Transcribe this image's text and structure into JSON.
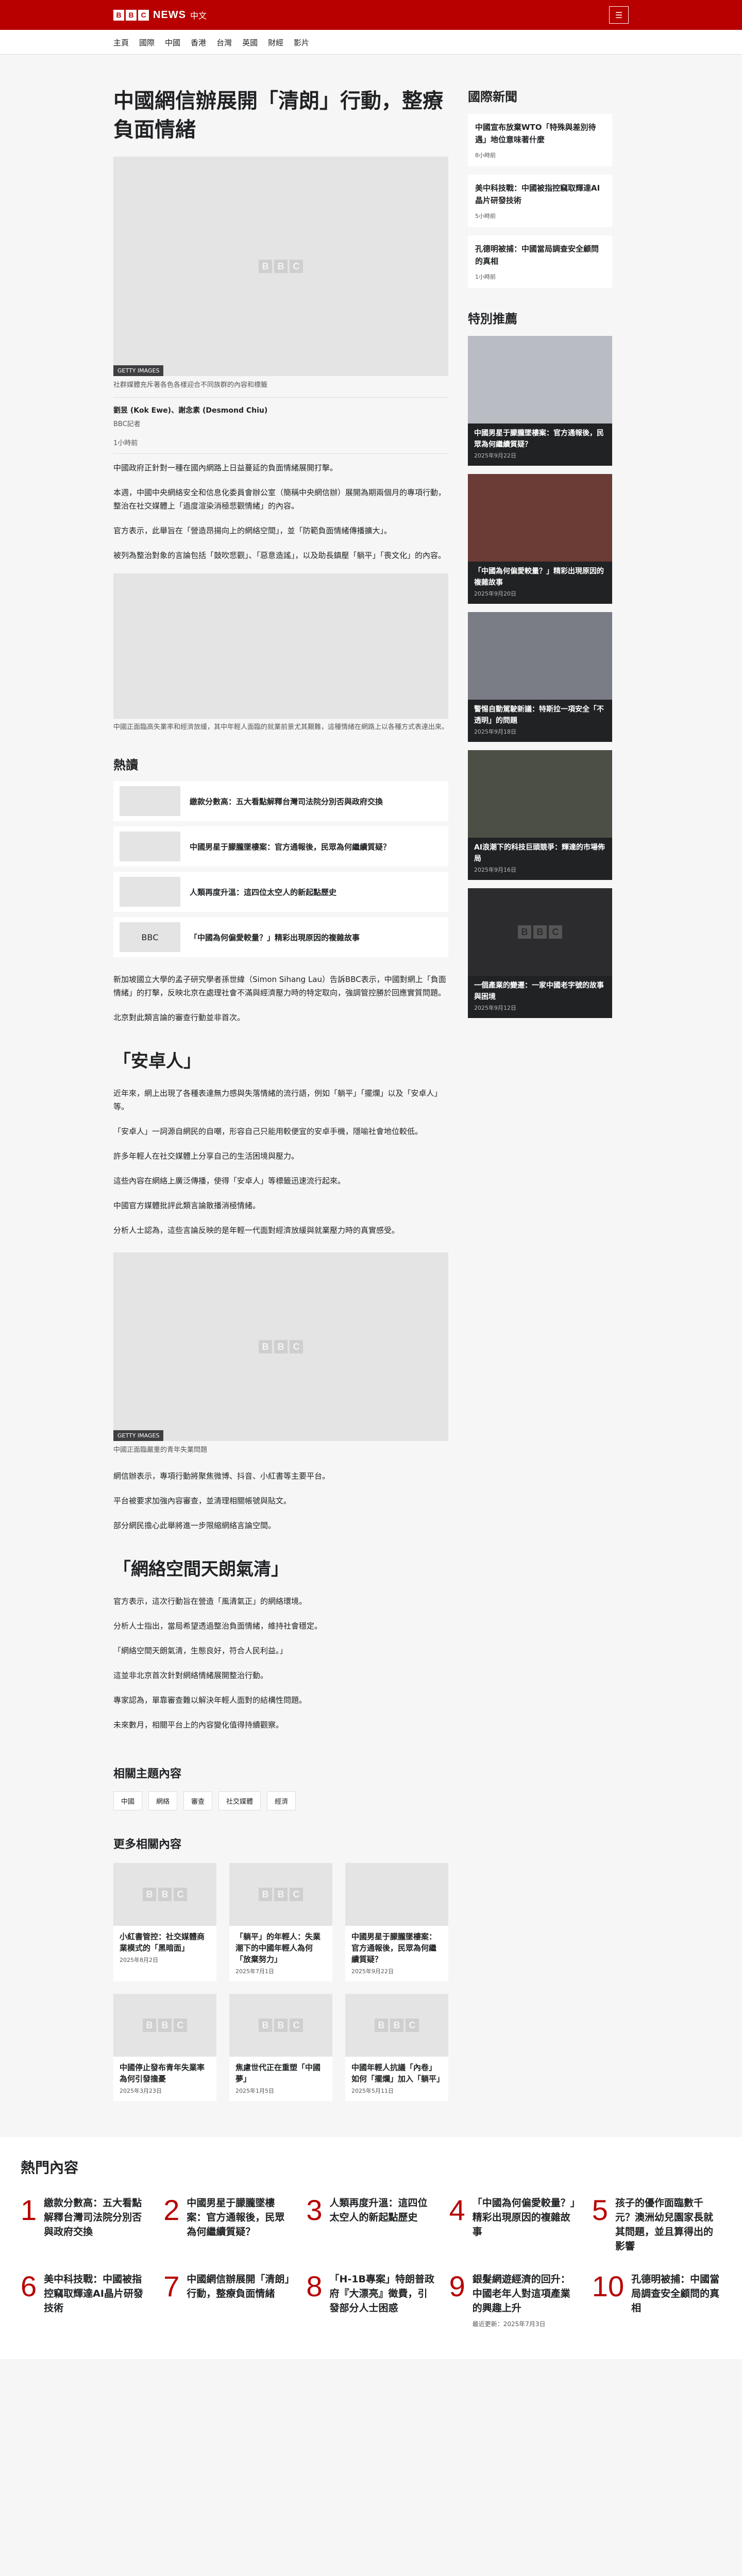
{
  "header": {
    "brand_letters": [
      "B",
      "B",
      "C"
    ],
    "brand_news": "NEWS",
    "brand_zh": "中文",
    "menu_icon": "☰"
  },
  "nav": [
    "主頁",
    "國際",
    "中國",
    "香港",
    "台灣",
    "英國",
    "財經",
    "影片"
  ],
  "article": {
    "title": "中國網信辦展開「清朗」行動，整療負面情緒",
    "image_credit": "GETTY IMAGES",
    "image_caption": "社群媒體充斥著各色各樣迎合不同族群的內容和標籤",
    "byline_name": "劉昱 (Kok Ewe)、謝念素 (Desmond Chiu)",
    "byline_org": "BBC記者",
    "date": "1小時前",
    "paras_a": [
      "中國政府正針對一種在國內網路上日益蔓延的負面情緒展開打擊。",
      "本週，中國中央網絡安全和信息化委員會辦公室（簡稱中央網信辦）展開為期兩個月的專項行動，整治在社交媒體上「過度渲染消極悲觀情緒」的內容。",
      "官方表示，此舉旨在「營造昂揚向上的網絡空間」，並「防範負面情緒傳播擴大」。",
      "被列為整治對象的言論包括「鼓吹悲觀」、「惡意造謠」，以及助長鎮壓「躺平」「喪文化」的內容。"
    ],
    "inline_caption": "中國正面臨高失業率和經濟放緩，其中年輕人面臨的就業前景尤其艱難，這種情緒在網路上以各種方式表達出來。",
    "hot_heading": "熱讀",
    "hot_items": [
      "繳款分數高：五大看點解釋台灣司法院分別否與政府交換",
      "中國男星于朦朧墜樓案：官方通報後，民眾為何繼續質疑？",
      "人類再度升溫：這四位太空人的新起點歷史",
      "「中國為何偏愛較量？」精彩出現原因的複雜故事"
    ],
    "paras_b": [
      "新加坡國立大學的孟子研究學者孫世緯（Simon Sihang Lau）告訴BBC表示，中國對網上「負面情緒」的打擊，反映北京在處理社會不滿與經濟壓力時的特定取向，強調管控勝於回應實質問題。",
      "北京對此類言論的審查行動並非首次。"
    ],
    "section_1": "「安卓人」",
    "paras_c": [
      "近年來，網上出現了各種表達無力感與失落情緒的流行語，例如「躺平」「擺爛」以及「安卓人」等。",
      "「安卓人」一詞源自網民的自嘲，形容自己只能用較便宜的安卓手機，隱喻社會地位較低。",
      "許多年輕人在社交媒體上分享自己的生活困境與壓力。",
      "這些內容在網絡上廣泛傳播，使得「安卓人」等標籤迅速流行起來。",
      "中國官方媒體批評此類言論散播消極情緒。",
      "分析人士認為，這些言論反映的是年輕一代面對經濟放緩與就業壓力時的真實感受。"
    ],
    "inline2_credit": "GETTY IMAGES",
    "inline2_caption": "中國正面臨嚴重的青年失業問題",
    "paras_d": [
      "網信辦表示，專項行動將聚焦微博、抖音、小紅書等主要平台。",
      "平台被要求加強內容審查，並清理相關帳號與貼文。",
      "部分網民擔心此舉將進一步限縮網絡言論空間。"
    ],
    "section_2": "「網絡空間天朗氣清」",
    "paras_e": [
      "官方表示，這次行動旨在營造「風清氣正」的網絡環境。",
      "分析人士指出，當局希望透過整治負面情緒，維持社會穩定。",
      "「網絡空間天朗氣清，生態良好，符合人民利益。」",
      "這並非北京首次針對網絡情緒展開整治行動。",
      "專家認為，單靠審查難以解決年輕人面對的結構性問題。",
      "未來數月，相關平台上的內容變化值得持續觀察。"
    ],
    "topics_heading": "相關主題內容",
    "topics": [
      "中國",
      "網絡",
      "審查",
      "社交媒體",
      "經濟"
    ],
    "more_heading": "更多相關內容",
    "more": [
      {
        "t": "小紅書管控：社交媒體商業模式的「黑暗面」",
        "d": "2025年8月2日"
      },
      {
        "t": "「躺平」的年輕人：失業潮下的中國年輕人為何「放棄努力」",
        "d": "2025年7月1日"
      },
      {
        "t": "中國男星于朦朧墜樓案：官方通報後，民眾為何繼續質疑？",
        "d": "2025年9月22日"
      },
      {
        "t": "中國停止發布青年失業率 為何引發擔憂",
        "d": "2025年3月23日"
      },
      {
        "t": "焦慮世代正在重塑「中國夢」",
        "d": "2025年1月5日"
      },
      {
        "t": "中國年輕人抗議「內卷」如何「擺爛」加入「躺平」",
        "d": "2025年5月11日"
      }
    ]
  },
  "sidebar": {
    "top_heading": "國際新聞",
    "top": [
      {
        "t": "中國宣布放棄WTO「特殊與差別待遇」地位意味著什麼",
        "d": "8小時前"
      },
      {
        "t": "美中科技戰：中國被指控竊取輝達AI晶片研發技術",
        "d": "5小時前"
      },
      {
        "t": "孔德明被捕：中國當局調查安全顧問的真相",
        "d": "1小時前"
      }
    ],
    "feat_heading": "特別推薦",
    "feat": [
      {
        "t": "中國男星于朦朧墜樓案：官方通報後，民眾為何繼續質疑？",
        "d": "2025年9月22日"
      },
      {
        "t": "「中國為何偏愛較量？」精彩出現原因的複雜故事",
        "d": "2025年9月20日"
      },
      {
        "t": "警惕自動駕駛新議：特斯拉一項安全「不透明」的問題",
        "d": "2025年9月18日"
      },
      {
        "t": "AI浪潮下的科技巨頭競爭：輝達的市場佈局",
        "d": "2025年9月16日"
      },
      {
        "t": "一個產業的變遷：一家中國老字號的故事與困境",
        "d": "2025年9月12日"
      }
    ]
  },
  "most_read": {
    "heading": "熱門內容",
    "items": [
      {
        "n": "1",
        "t": "繳款分數高：五大看點解釋台灣司法院分別否與政府交換"
      },
      {
        "n": "2",
        "t": "中國男星于朦朧墜樓案：官方通報後，民眾為何繼續質疑？"
      },
      {
        "n": "3",
        "t": "人類再度升溫：這四位太空人的新起點歷史"
      },
      {
        "n": "4",
        "t": "「中國為何偏愛較量？」精彩出現原因的複雜故事"
      },
      {
        "n": "5",
        "t": "孩子的優作面臨數千元？澳洲幼兒園家長就其問題，並且算得出的影響"
      },
      {
        "n": "6",
        "t": "美中科技戰：中國被指控竊取輝達AI晶片研發技術"
      },
      {
        "n": "7",
        "t": "中國網信辦展開「清朗」行動，整療負面情緒"
      },
      {
        "n": "8",
        "t": "「H-1B專案」特朗普政府『大漂亮』徵費，引發部分人士困惑"
      },
      {
        "n": "9",
        "t": "銀髮網遊經濟的回升：中國老年人對這項產業的興趣上升",
        "d": "最近更新：2025年7月3日"
      },
      {
        "n": "10",
        "t": "孔德明被捕：中國當局調查安全顧問的真相"
      }
    ]
  }
}
